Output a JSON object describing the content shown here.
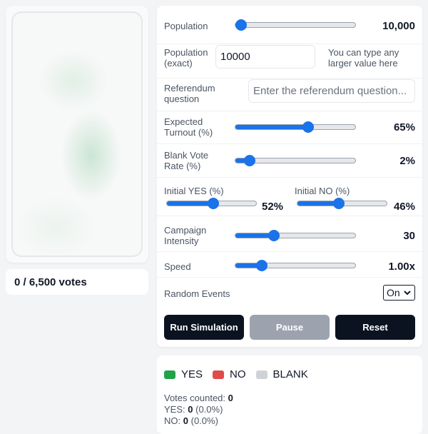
{
  "votes_counter": "0 / 6,500 votes",
  "controls": {
    "population": {
      "label": "Population",
      "value": "10,000",
      "fraction": 0.05
    },
    "population_exact": {
      "label_line1": "Population",
      "label_line2": "(exact)",
      "value": "10000",
      "hint_line1": "You can type any",
      "hint_line2": "larger value here"
    },
    "question": {
      "label_line1": "Referendum",
      "label_line2": "question",
      "placeholder": "Enter the referendum question..."
    },
    "turnout": {
      "label_line1": "Expected",
      "label_line2": "Turnout (%)",
      "value": "65%",
      "fraction": 0.61
    },
    "blank": {
      "label_line1": "Blank Vote",
      "label_line2": "Rate (%)",
      "value": "2%",
      "fraction": 0.12
    },
    "initial_yes": {
      "label": "Initial YES (%)",
      "value": "52%",
      "fraction": 0.52
    },
    "initial_no": {
      "label": "Initial NO (%)",
      "value": "46%",
      "fraction": 0.46
    },
    "campaign": {
      "label_line1": "Campaign",
      "label_line2": "Intensity",
      "value": "30",
      "fraction": 0.32
    },
    "speed": {
      "label": "Speed",
      "value": "1.00x",
      "fraction": 0.22
    },
    "random_events": {
      "label": "Random Events",
      "selected": "On"
    }
  },
  "buttons": {
    "run": "Run Simulation",
    "pause": "Pause",
    "reset": "Reset"
  },
  "legend": {
    "yes": {
      "label": "YES",
      "color": "#22a34a"
    },
    "no": {
      "label": "NO",
      "color": "#e04b4b"
    },
    "blank": {
      "label": "BLANK",
      "color": "#cfd3d8"
    }
  },
  "stats": {
    "counted_label": "Votes counted:",
    "counted_value": "0",
    "yes_label": "YES:",
    "yes_value": "0",
    "yes_pct": "(0.0%)",
    "no_label": "NO:",
    "no_value": "0",
    "no_pct": "(0.0%)"
  },
  "colors": {
    "accent": "#1a73e8",
    "dark_button": "#0b1320",
    "disabled_button": "#9ca3af"
  }
}
